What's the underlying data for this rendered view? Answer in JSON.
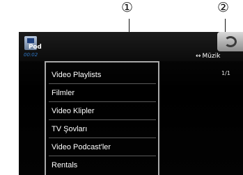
{
  "callouts": {
    "first": "①",
    "second": "②"
  },
  "header": {
    "source_label": "Pod",
    "time": "00:02",
    "mode_label": "Müzik",
    "mode_icon": "left-right-arrow-icon",
    "back_icon": "return-arrow-icon",
    "page_indicator": "1/1"
  },
  "menu": {
    "items": [
      {
        "label": "Video Playlists"
      },
      {
        "label": "Filmler"
      },
      {
        "label": "Video Klipler"
      },
      {
        "label": "TV Şovları"
      },
      {
        "label": "Video Podcast'ler"
      },
      {
        "label": "Rentals"
      }
    ]
  },
  "colors": {
    "screen_background": "#000000",
    "menu_border": "#a9a9a9",
    "time_text": "#2f78c7",
    "text": "#ffffff"
  }
}
